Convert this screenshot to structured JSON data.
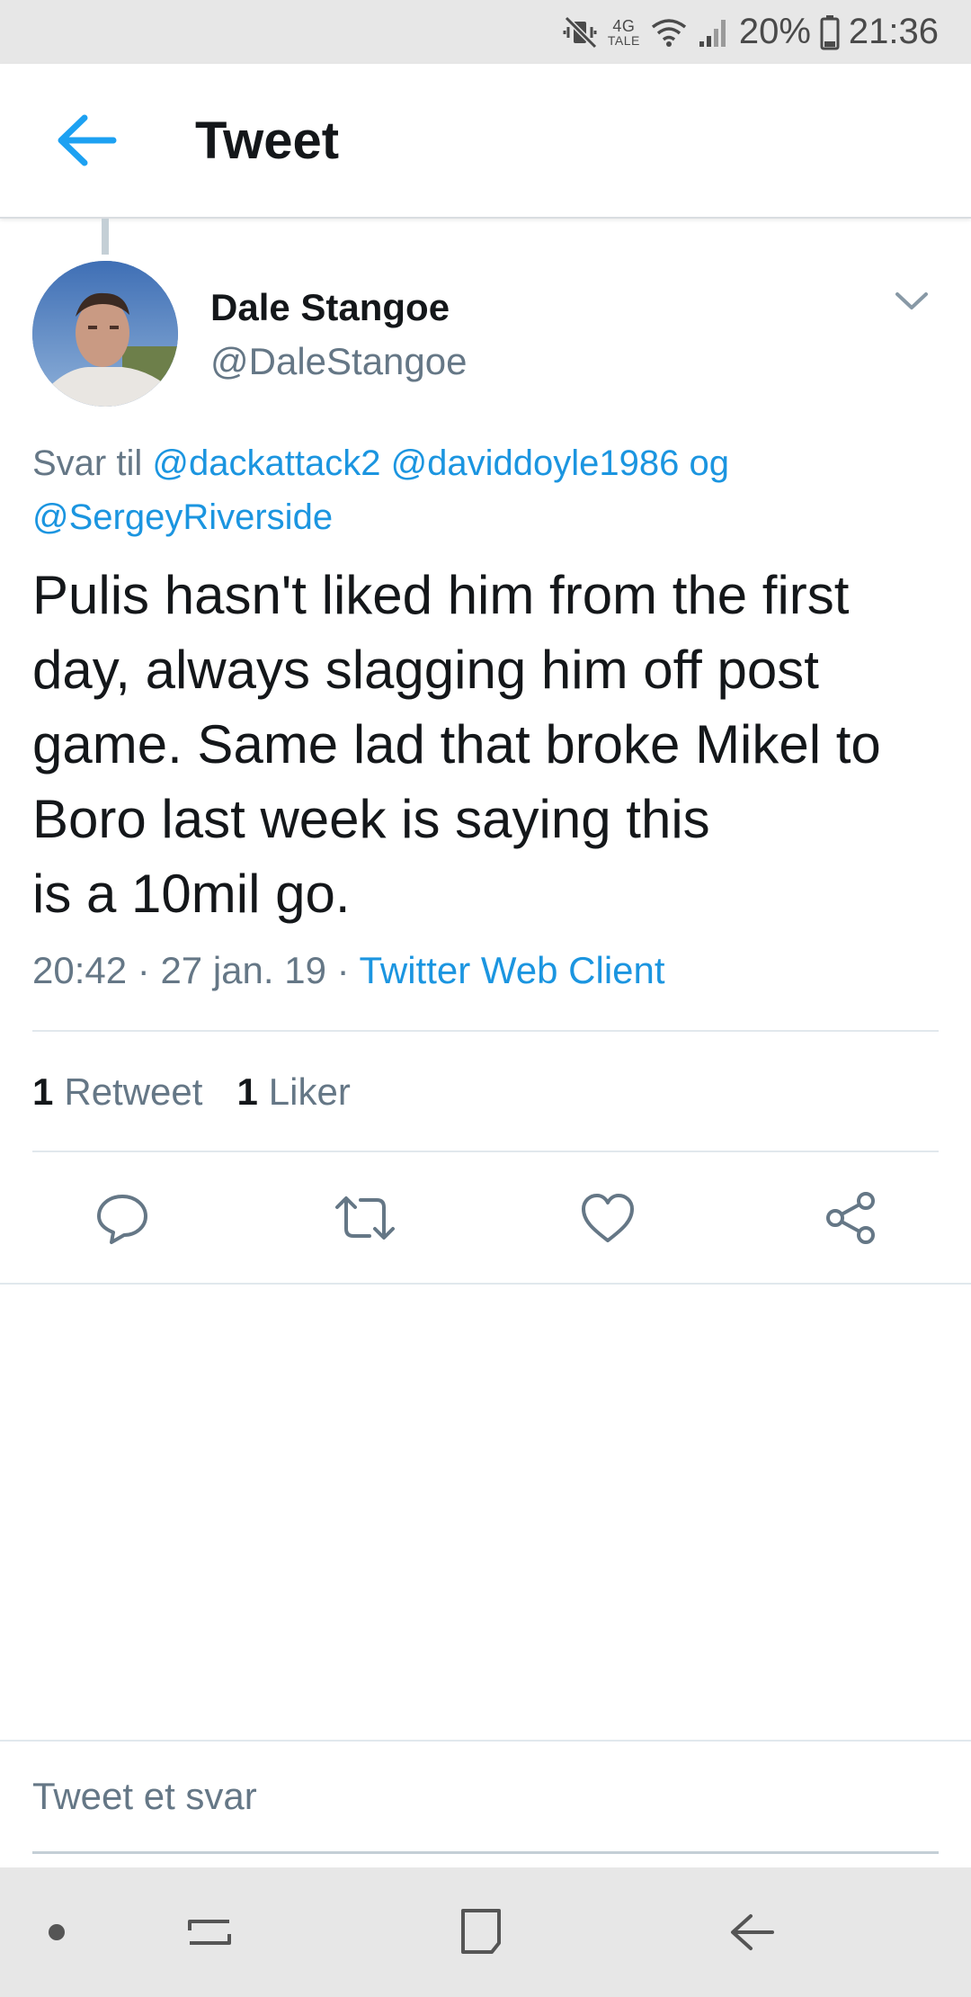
{
  "status_bar": {
    "network_type": "4G",
    "network_sub": "TALE",
    "battery": "20%",
    "time": "21:36",
    "icons": [
      "mute-vibrate-icon",
      "wifi-icon",
      "signal-icon",
      "battery-icon"
    ]
  },
  "header": {
    "title": "Tweet",
    "back_icon": "arrow-left-icon"
  },
  "tweet": {
    "display_name": "Dale Stangoe",
    "username": "@DaleStangoe",
    "reply_prefix": "Svar til",
    "mentions": [
      "@dackattack2",
      "@daviddoyle1986",
      "@SergeyRiverside"
    ],
    "mention_joiner": "og",
    "text": "Pulis hasn't liked him from the first day, always slagging him off post game. Same lad that broke Mikel to Boro last week is saying this\nis a 10mil go.",
    "time": "20:42",
    "date": "27 jan. 19",
    "separator": "·",
    "source": "Twitter Web Client",
    "retweet_count": "1",
    "retweet_label": "Retweet",
    "like_count": "1",
    "like_label": "Liker"
  },
  "actions": [
    "reply-icon",
    "retweet-icon",
    "like-icon",
    "share-icon"
  ],
  "reply_box": {
    "placeholder": "Tweet et svar"
  },
  "colors": {
    "accent": "#1da1f2",
    "link": "#1b95e0",
    "secondary_text": "#657786",
    "primary_text": "#14171a",
    "system_bar": "#e7e7e7"
  }
}
